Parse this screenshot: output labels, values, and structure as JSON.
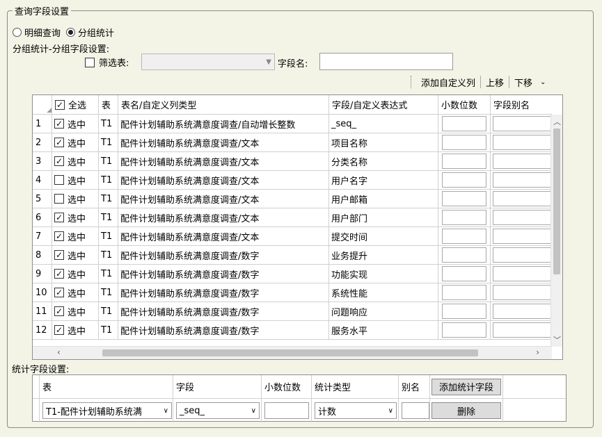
{
  "group_title": "查询字段设置",
  "mode": {
    "options": [
      {
        "label": "明细查询",
        "selected": false
      },
      {
        "label": "分组统计",
        "selected": true
      }
    ]
  },
  "group_settings_label": "分组统计-分组字段设置:",
  "filter": {
    "checked": false,
    "label": "筛选表:",
    "value": ""
  },
  "field_name": {
    "label": "字段名:",
    "value": ""
  },
  "toolbar": {
    "add_custom_column": "添加自定义列",
    "move_up": "上移",
    "move_down": "下移"
  },
  "grid": {
    "headers": {
      "select_all": "全选",
      "table": "表",
      "table_name": "表名/自定义列类型",
      "field_expr": "字段/自定义表达式",
      "decimals": "小数位数",
      "alias": "字段别名"
    },
    "select_all_checked": true,
    "select_label": "选中",
    "rows": [
      {
        "num": "1",
        "checked": true,
        "table": "T1",
        "name": "配件计划辅助系统满意度调查/自动增长整数",
        "field": "_seq_"
      },
      {
        "num": "2",
        "checked": true,
        "table": "T1",
        "name": "配件计划辅助系统满意度调查/文本",
        "field": "项目名称"
      },
      {
        "num": "3",
        "checked": true,
        "table": "T1",
        "name": "配件计划辅助系统满意度调查/文本",
        "field": "分类名称"
      },
      {
        "num": "4",
        "checked": false,
        "table": "T1",
        "name": "配件计划辅助系统满意度调查/文本",
        "field": "用户名字"
      },
      {
        "num": "5",
        "checked": false,
        "table": "T1",
        "name": "配件计划辅助系统满意度调查/文本",
        "field": "用户邮箱"
      },
      {
        "num": "6",
        "checked": true,
        "table": "T1",
        "name": "配件计划辅助系统满意度调查/文本",
        "field": "用户部门"
      },
      {
        "num": "7",
        "checked": true,
        "table": "T1",
        "name": "配件计划辅助系统满意度调查/文本",
        "field": "提交时间"
      },
      {
        "num": "8",
        "checked": true,
        "table": "T1",
        "name": "配件计划辅助系统满意度调查/数字",
        "field": "业务提升"
      },
      {
        "num": "9",
        "checked": true,
        "table": "T1",
        "name": "配件计划辅助系统满意度调查/数字",
        "field": "功能实现"
      },
      {
        "num": "10",
        "checked": true,
        "table": "T1",
        "name": "配件计划辅助系统满意度调查/数字",
        "field": "系统性能"
      },
      {
        "num": "11",
        "checked": true,
        "table": "T1",
        "name": "配件计划辅助系统满意度调查/数字",
        "field": "问题响应"
      },
      {
        "num": "12",
        "checked": true,
        "table": "T1",
        "name": "配件计划辅助系统满意度调查/数字",
        "field": "服务水平"
      }
    ]
  },
  "stats": {
    "label": "统计字段设置:",
    "headers": {
      "table": "表",
      "field": "字段",
      "decimals": "小数位数",
      "stat_type": "统计类型",
      "alias": "别名"
    },
    "add_button": "添加统计字段",
    "row": {
      "table": "T1-配件计划辅助系统满",
      "field": "_seq_",
      "decimals": "",
      "stat_type": "计数",
      "alias": ""
    },
    "delete_button": "删除"
  }
}
